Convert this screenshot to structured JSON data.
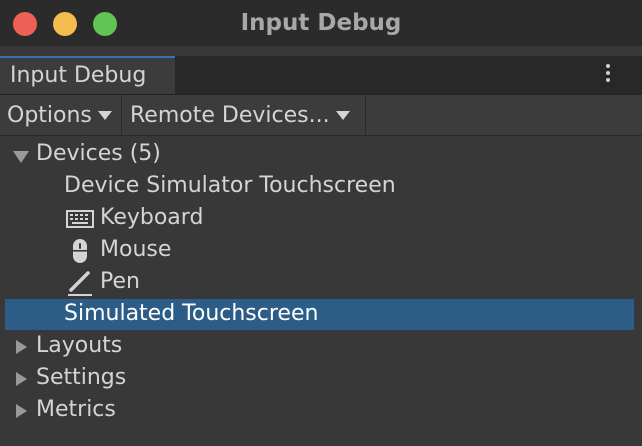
{
  "window": {
    "title": "Input Debug"
  },
  "tab": {
    "label": "Input Debug"
  },
  "toolbar": {
    "options_label": "Options",
    "remote_label": "Remote Devices..."
  },
  "tree": {
    "devices": {
      "label": "Devices (5)",
      "expanded": true,
      "children": [
        {
          "label": "Device Simulator Touchscreen",
          "icon": null
        },
        {
          "label": "Keyboard",
          "icon": "keyboard-icon"
        },
        {
          "label": "Mouse",
          "icon": "mouse-icon"
        },
        {
          "label": "Pen",
          "icon": "pen-icon"
        },
        {
          "label": "Simulated Touchscreen",
          "icon": null,
          "selected": true
        }
      ]
    },
    "layouts": {
      "label": "Layouts",
      "expanded": false
    },
    "settings": {
      "label": "Settings",
      "expanded": false
    },
    "metrics": {
      "label": "Metrics",
      "expanded": false
    }
  },
  "colors": {
    "selection": "#2c5d87",
    "tab_accent": "#3a72b0",
    "close": "#ed5f57",
    "minimize": "#f5bd4f",
    "maximize": "#61c554"
  }
}
